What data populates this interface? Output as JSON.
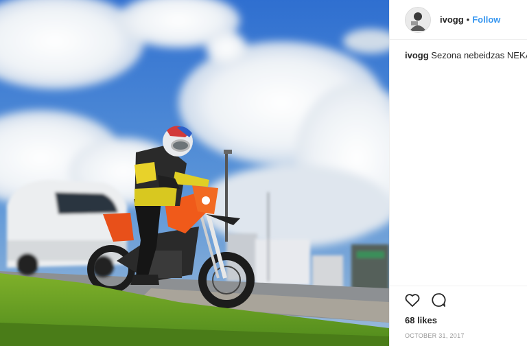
{
  "post": {
    "username": "ivogg",
    "separator": "•",
    "follow_label": "Follow",
    "caption_user": "ivogg",
    "caption_text": "Sezona nebeidzas NEKAD",
    "likes": "68 likes",
    "date": "OCTOBER 31, 2017"
  },
  "icons": {
    "like": "heart-icon",
    "comment": "comment-bubble-icon"
  },
  "colors": {
    "follow": "#3897f0",
    "bike_orange": "#f05a1a"
  }
}
